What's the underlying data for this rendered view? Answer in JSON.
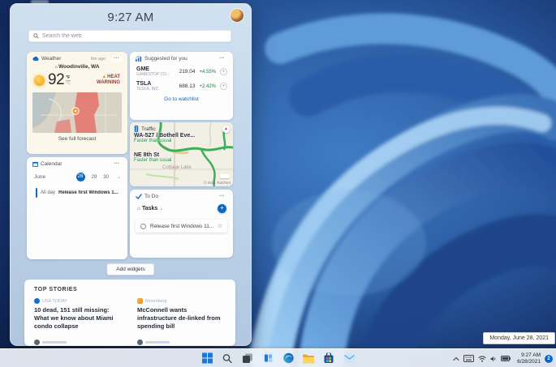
{
  "desktop": {
    "tooltip": "Monday, June 28, 2021"
  },
  "colors": {
    "accent": "#0b67c2",
    "gain_green": "#188038",
    "warning_red": "#9d3a2e",
    "traffic_green": "#3fae5a"
  },
  "icons": {
    "ellipsis": "•••",
    "plus": "+",
    "star": "☆",
    "chevron_down": "⌄",
    "home": "⌂",
    "warning_triangle": "▲",
    "compass_needle": "▲"
  },
  "panel": {
    "time": "9:27 AM",
    "search_placeholder": "Search the web",
    "add_widgets_label": "Add widgets",
    "weather": {
      "title": "Weather",
      "updated": "6m ago",
      "location": "Woodinville, WA",
      "temp": "92",
      "unit_f": "°F",
      "unit_c": "°C",
      "warning_line1": "HEAT",
      "warning_line2": "WARNING",
      "link": "See full forecast"
    },
    "stocks": {
      "title": "Suggested for you",
      "items": [
        {
          "symbol": "GME",
          "name": "GAMESTOP CO...",
          "price": "219.04",
          "change": "+4.55%"
        },
        {
          "symbol": "TSLA",
          "name": "TESLA, INC.",
          "price": "688.13",
          "change": "+2.42%"
        }
      ],
      "link": "Go to watchlist"
    },
    "traffic": {
      "title": "Traffic",
      "routes": [
        {
          "name": "WA-527 / Bothell Eve...",
          "status": "Faster than usual"
        },
        {
          "name": "NE 8th St",
          "status": "Faster than usual"
        }
      ],
      "map_label": "Cottage Lake",
      "attribution": "© 2021 TomTom"
    },
    "calendar": {
      "title": "Calendar",
      "month": "June",
      "dates": [
        "28",
        "29",
        "30"
      ],
      "selected_date": "28",
      "event_time": "All day",
      "event_title": "Release first Windows 1..."
    },
    "todo": {
      "title": "To Do",
      "list_label": "Tasks",
      "task": "Release first Windows 11..."
    },
    "news": {
      "header": "TOP STORIES",
      "articles": [
        {
          "source": "USA TODAY",
          "headline": "10 dead, 151 still missing: What we know about Miami condo collapse"
        },
        {
          "source": "Bloomberg",
          "headline": "McConnell wants infrastructure de-linked from spending bill"
        }
      ]
    }
  },
  "taskbar": {
    "clock_time": "9:27 AM",
    "clock_date": "6/28/2021",
    "badge": "2"
  }
}
